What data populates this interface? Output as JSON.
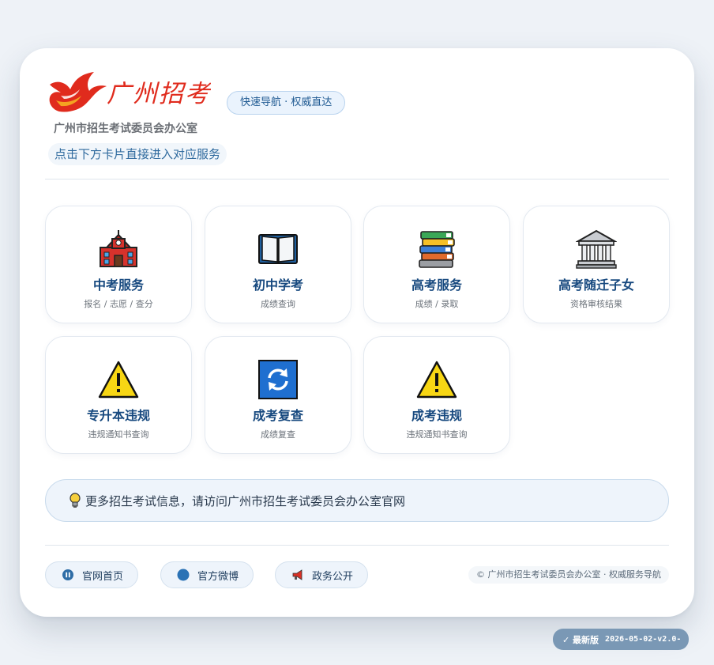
{
  "header": {
    "logo_text": "广州招考",
    "org_name": "广州市招生考试委员会办公室",
    "badge": "快速导航 · 权威直达",
    "hint": "点击下方卡片直接进入对应服务"
  },
  "tiles": [
    {
      "title": "中考服务",
      "subtitle": "报名 / 志愿 / 查分",
      "icon": "school-icon"
    },
    {
      "title": "初中学考",
      "subtitle": "成绩查询",
      "icon": "open-book-icon"
    },
    {
      "title": "高考服务",
      "subtitle": "成绩 / 录取",
      "icon": "books-icon"
    },
    {
      "title": "高考随迁子女",
      "subtitle": "资格审核结果",
      "icon": "classical-building-icon"
    },
    {
      "title": "专升本违规",
      "subtitle": "违规通知书查询",
      "icon": "warning-icon"
    },
    {
      "title": "成考复查",
      "subtitle": "成绩复查",
      "icon": "refresh-icon"
    },
    {
      "title": "成考违规",
      "subtitle": "违规通知书查询",
      "icon": "warning-icon"
    }
  ],
  "info": {
    "icon": "light-bulb-icon",
    "text": "更多招生考试信息，请访问广州市招生考试委员会办公室官网"
  },
  "footer": {
    "links": [
      {
        "label": "官网首页",
        "icon": "pause-circle-icon"
      },
      {
        "label": "官方微博",
        "icon": "blue-circle-icon"
      },
      {
        "label": "政务公开",
        "icon": "megaphone-icon"
      }
    ],
    "copyright": "© 广州市招生考试委员会办公室 · 权威服务导航"
  },
  "version": {
    "label": "✓ 最新版",
    "date": "2026-05-02-v2.0-"
  },
  "colors": {
    "accent": "#17497f",
    "logo_red": "#e02b1d",
    "background": "#eef2f7"
  }
}
